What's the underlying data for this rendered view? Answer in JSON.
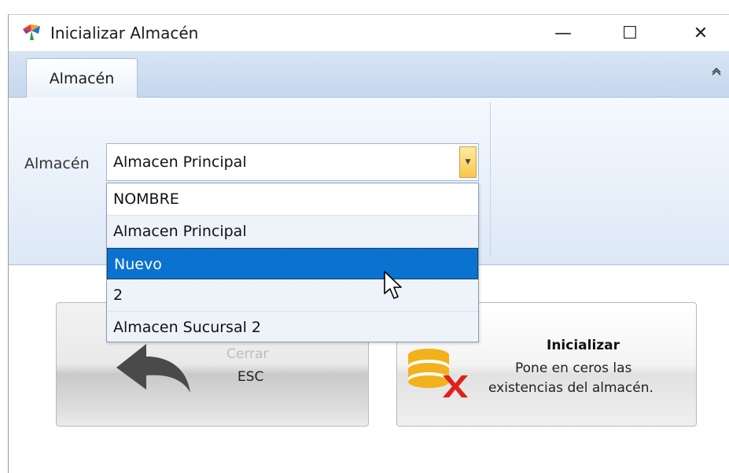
{
  "window": {
    "title": "Inicializar Almacén",
    "controls": {
      "minimize": "—",
      "maximize": "☐",
      "close": "✕"
    }
  },
  "ribbon": {
    "tab_label": "Almacén",
    "collapse_icon": "chevron-up-icon"
  },
  "almacen_field": {
    "label": "Almacén",
    "value": "Almacen Principal"
  },
  "dropdown": {
    "header": "NOMBRE",
    "options": [
      "Almacen Principal",
      "Nuevo",
      "2",
      "Almacen Sucursal 2"
    ],
    "highlighted": "Nuevo"
  },
  "buttons": {
    "cerrar": {
      "title": "Cerrar",
      "shortcut": "ESC",
      "icon": "undo-arrow-icon"
    },
    "inicializar": {
      "title": "Inicializar",
      "description_line1": "Pone en ceros las",
      "description_line2": "existencias del almacén.",
      "icon": "database-delete-icon"
    }
  },
  "colors": {
    "ribbon_bg": "#c6d8ee",
    "selection": "#0a72cf",
    "combo_arrow": "#f8c74d",
    "delete_red": "#e0201b",
    "database_yellow": "#f2b21c"
  }
}
